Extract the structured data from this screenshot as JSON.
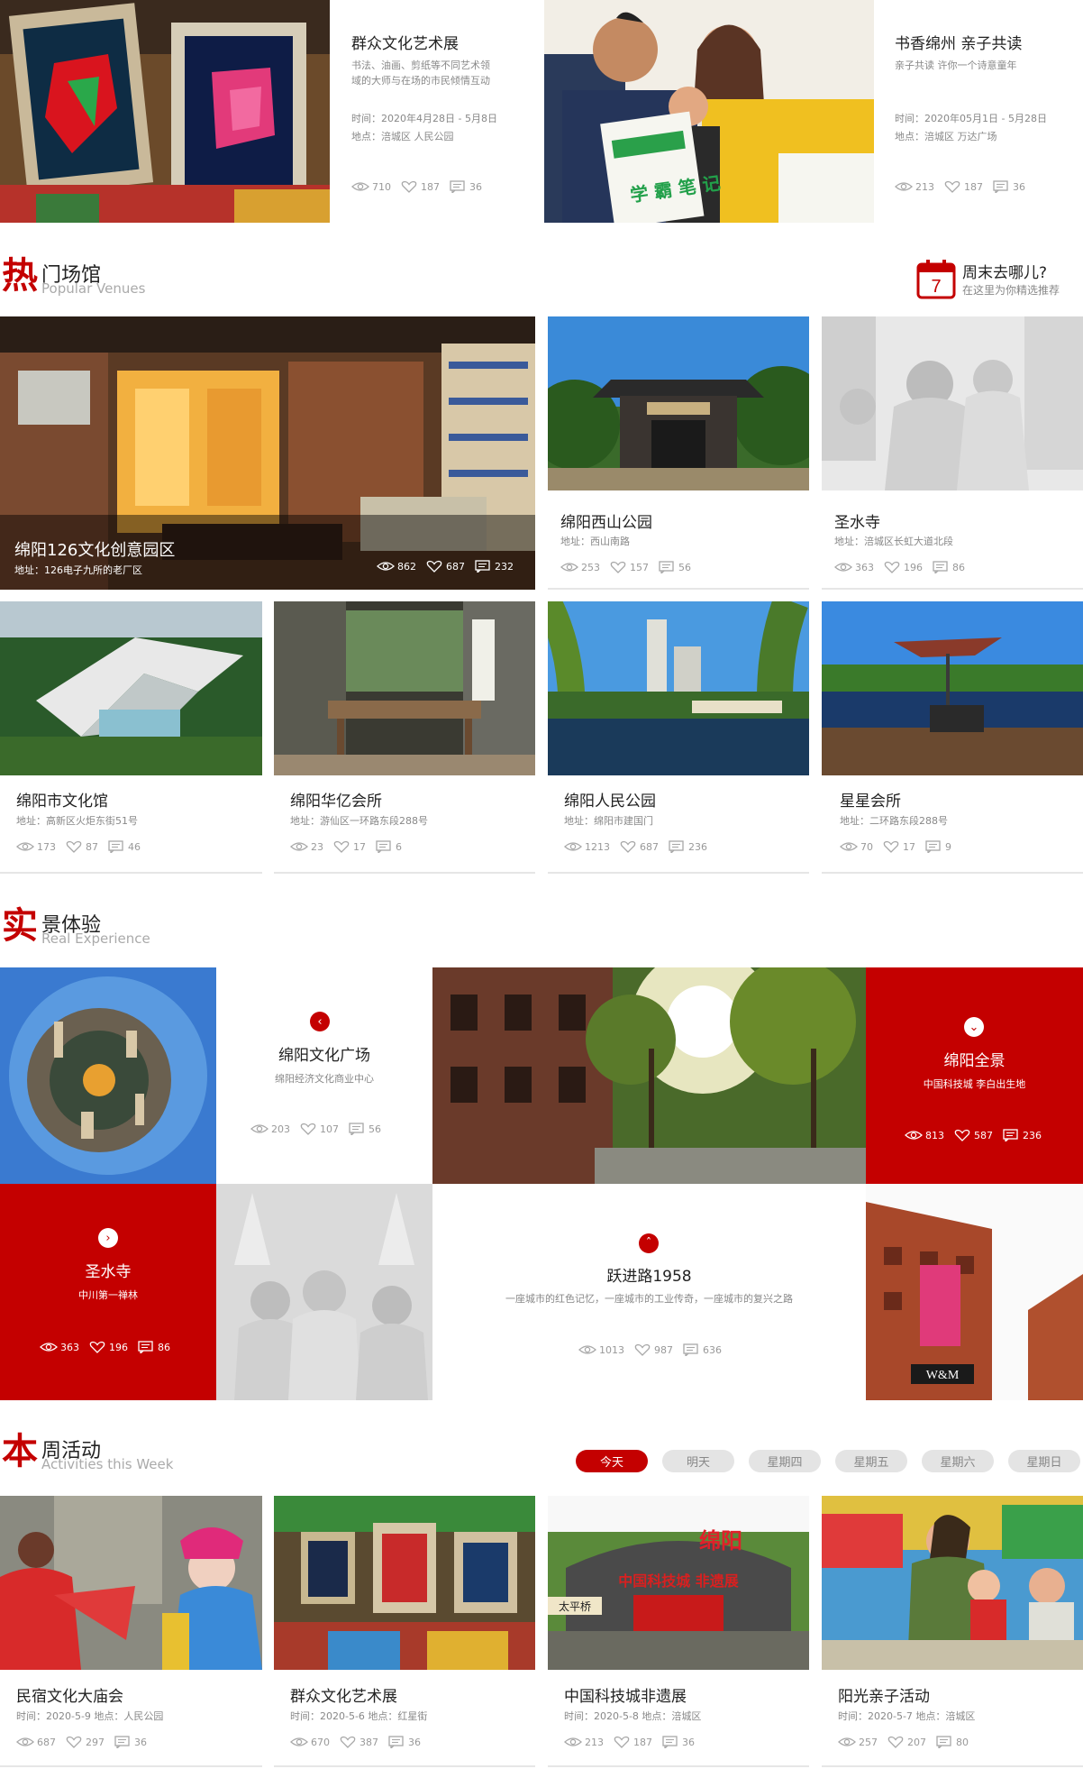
{
  "top_events": [
    {
      "title": "群众文化艺术展",
      "desc_line1": "书法、油画、剪纸等不同艺术领",
      "desc_line2": "域的大师与在场的市民倾情互动",
      "time": "时间：2020年4月28日 - 5月8日",
      "place": "地点：涪城区 人民公园",
      "views": "710",
      "likes": "187",
      "comments": "36"
    },
    {
      "title": "书香绵州 亲子共读",
      "desc_line1": "亲子共读 许你一个诗意童年",
      "desc_line2": "",
      "time": "时间：2020年05月1日 - 5月28日",
      "place": "地点：涪城区 万达广场",
      "views": "213",
      "likes": "187",
      "comments": "36"
    }
  ],
  "venues_section": {
    "char": "热",
    "cn": "门场馆",
    "en": "Popular Venues",
    "weekend_title": "周末去哪儿?",
    "weekend_sub": "在这里为你精选推荐",
    "calendar_num": "7"
  },
  "venues": [
    {
      "title": "绵阳126文化创意园区",
      "addr": "地址：126电子九所的老厂区",
      "views": "862",
      "likes": "687",
      "comments": "232"
    },
    {
      "title": "绵阳西山公园",
      "addr": "地址：西山南路",
      "views": "253",
      "likes": "157",
      "comments": "56"
    },
    {
      "title": "圣水寺",
      "addr": "地址：涪城区长虹大道北段",
      "views": "363",
      "likes": "196",
      "comments": "86"
    },
    {
      "title": "绵阳市文化馆",
      "addr": "地址：高新区火炬东街51号",
      "views": "173",
      "likes": "87",
      "comments": "46"
    },
    {
      "title": "绵阳华亿会所",
      "addr": "地址：游仙区一环路东段288号",
      "views": "23",
      "likes": "17",
      "comments": "6"
    },
    {
      "title": "绵阳人民公园",
      "addr": "地址：绵阳市建国门",
      "views": "1213",
      "likes": "687",
      "comments": "236"
    },
    {
      "title": "星星会所",
      "addr": "地址：二环路东段288号",
      "views": "70",
      "likes": "17",
      "comments": "9"
    }
  ],
  "experience_section": {
    "char": "实",
    "cn": "景体验",
    "en": "Real Experience"
  },
  "experiences": [
    {
      "title": "绵阳文化广场",
      "sub": "绵阳经济文化商业中心",
      "views": "203",
      "likes": "107",
      "comments": "56"
    },
    {
      "title": "绵阳全景",
      "sub": "中国科技城 李白出生地",
      "views": "813",
      "likes": "587",
      "comments": "236"
    },
    {
      "title": "圣水寺",
      "sub": "中川第一禅林",
      "views": "363",
      "likes": "196",
      "comments": "86"
    },
    {
      "title": "跃进路1958",
      "sub": "一座城市的红色记忆，一座城市的工业传奇，一座城市的复兴之路",
      "views": "1013",
      "likes": "987",
      "comments": "636"
    }
  ],
  "activities_section": {
    "char": "本",
    "cn": "周活动",
    "en": "Activities this Week"
  },
  "day_tabs": [
    "今天",
    "明天",
    "星期四",
    "星期五",
    "星期六",
    "星期日"
  ],
  "activities": [
    {
      "title": "民宿文化大庙会",
      "meta": "时间：2020-5-9   地点：人民公园",
      "views": "687",
      "likes": "297",
      "comments": "36"
    },
    {
      "title": "群众文化艺术展",
      "meta": "时间：2020-5-6   地点：红星街",
      "views": "670",
      "likes": "387",
      "comments": "36"
    },
    {
      "title": "中国科技城非遗展",
      "meta": "时间：2020-5-8   地点：涪城区",
      "views": "213",
      "likes": "187",
      "comments": "36"
    },
    {
      "title": "阳光亲子活动",
      "meta": "时间：2020-5-7   地点：涪城区",
      "views": "257",
      "likes": "207",
      "comments": "80"
    }
  ],
  "image_labels": {
    "book_cover": "学 霸 笔 记",
    "banner_cn": "绵阳",
    "banner_sub": "中国科技城 非遗展",
    "gate_sign": "太平桥",
    "building_sign": "W&M"
  },
  "colors": {
    "accent": "#c40000",
    "tab_inactive": "#e4e4e4"
  }
}
